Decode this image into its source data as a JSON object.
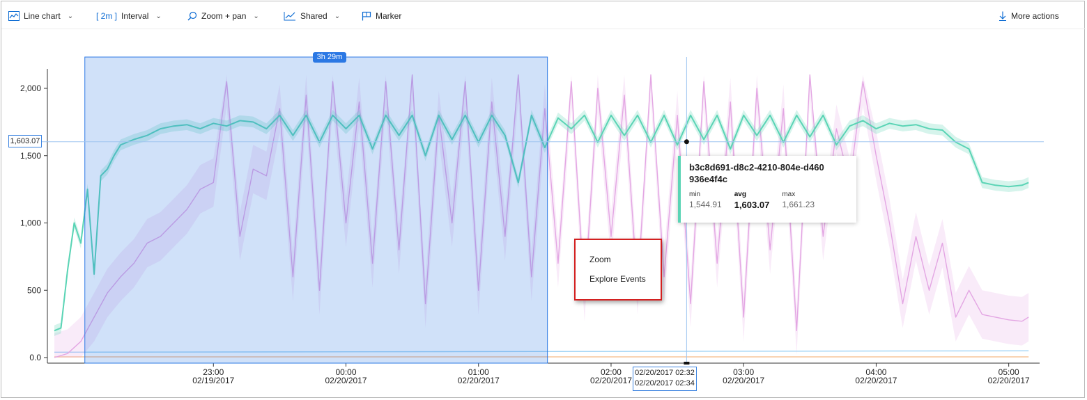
{
  "toolbar": {
    "chart_type_label": "Line chart",
    "interval_value": "[ 2m ]",
    "interval_label": "Interval",
    "zoom_label": "Zoom + pan",
    "shared_label": "Shared",
    "marker_label": "Marker",
    "more_actions_label": "More actions"
  },
  "selection": {
    "duration_label": "3h 29m"
  },
  "hover": {
    "value_label": "1,603.07",
    "time_start": "02/20/2017 02:32",
    "time_end": "02/20/2017 02:34"
  },
  "tooltip": {
    "series_id": "b3c8d691-d8c2-4210-804e-d460936e4f4c",
    "color": "#5ad4b5",
    "min_label": "min",
    "min_value": "1,544.91",
    "avg_label": "avg",
    "avg_value": "1,603.07",
    "max_label": "max",
    "max_value": "1,661.23"
  },
  "context_menu": {
    "items": [
      "Zoom",
      "Explore Events"
    ]
  },
  "colors": {
    "teal": "#5ad4b5",
    "pink": "#e3a6e3",
    "light_blue": "#9fd3f5",
    "orange": "#f7c59a",
    "selection": "#2b78e4",
    "accent": "#0c6bd3"
  },
  "chart_data": {
    "type": "line",
    "y_ticks": [
      {
        "value": 0,
        "label": "0.0"
      },
      {
        "value": 500,
        "label": "500"
      },
      {
        "value": 1000,
        "label": "1,000"
      },
      {
        "value": 1500,
        "label": "1,500"
      },
      {
        "value": 2000,
        "label": "2,000"
      }
    ],
    "ylim": [
      0,
      2150
    ],
    "xlim": [
      "02/19/2017 21:48",
      "02/20/2017 05:10"
    ],
    "x_ticks": [
      {
        "time": "23:00",
        "date": "02/19/2017",
        "hours": 1.2
      },
      {
        "time": "00:00",
        "date": "02/20/2017",
        "hours": 2.2
      },
      {
        "time": "01:00",
        "date": "02/20/2017",
        "hours": 3.2
      },
      {
        "time": "02:00",
        "date": "02/20/2017",
        "hours": 4.2
      },
      {
        "time": "03:00",
        "date": "02/20/2017",
        "hours": 5.2
      },
      {
        "time": "04:00",
        "date": "02/20/2017",
        "hours": 6.2
      },
      {
        "time": "05:00",
        "date": "02/20/2017",
        "hours": 7.2
      }
    ],
    "x_hours_range": [
      0,
      7.37
    ],
    "selection_hours": [
      0.23,
      3.72
    ],
    "hover_hours": 4.77,
    "hover_value": 1603.07,
    "series": [
      {
        "color": "#5ad4b5",
        "x": [
          0.0,
          0.05,
          0.1,
          0.15,
          0.2,
          0.25,
          0.3,
          0.35,
          0.4,
          0.45,
          0.5,
          0.6,
          0.7,
          0.8,
          0.9,
          1.0,
          1.1,
          1.2,
          1.3,
          1.4,
          1.5,
          1.6,
          1.7,
          1.8,
          1.9,
          2.0,
          2.1,
          2.2,
          2.3,
          2.4,
          2.5,
          2.6,
          2.7,
          2.8,
          2.9,
          3.0,
          3.1,
          3.2,
          3.3,
          3.4,
          3.5,
          3.6,
          3.7,
          3.8,
          3.9,
          4.0,
          4.1,
          4.2,
          4.3,
          4.4,
          4.5,
          4.6,
          4.7,
          4.8,
          4.9,
          5.0,
          5.1,
          5.2,
          5.3,
          5.4,
          5.5,
          5.6,
          5.7,
          5.8,
          5.9,
          6.0,
          6.1,
          6.2,
          6.3,
          6.4,
          6.5,
          6.6,
          6.7,
          6.8,
          6.9,
          7.0,
          7.1,
          7.2,
          7.3,
          7.35
        ],
        "values": [
          200,
          220,
          650,
          1000,
          850,
          1250,
          620,
          1350,
          1400,
          1500,
          1580,
          1620,
          1650,
          1700,
          1720,
          1730,
          1700,
          1740,
          1720,
          1760,
          1750,
          1700,
          1800,
          1650,
          1800,
          1600,
          1800,
          1700,
          1800,
          1550,
          1800,
          1650,
          1800,
          1500,
          1800,
          1620,
          1800,
          1600,
          1800,
          1650,
          1300,
          1800,
          1560,
          1780,
          1700,
          1800,
          1600,
          1800,
          1650,
          1800,
          1600,
          1800,
          1580,
          1800,
          1620,
          1800,
          1550,
          1800,
          1650,
          1800,
          1600,
          1800,
          1640,
          1800,
          1580,
          1720,
          1760,
          1700,
          1740,
          1720,
          1730,
          1700,
          1690,
          1600,
          1550,
          1300,
          1280,
          1270,
          1280,
          1300
        ]
      },
      {
        "color": "#e3a6e3",
        "x": [
          0.0,
          0.1,
          0.2,
          0.3,
          0.4,
          0.5,
          0.6,
          0.7,
          0.8,
          0.9,
          1.0,
          1.1,
          1.2,
          1.3,
          1.4,
          1.5,
          1.6,
          1.7,
          1.8,
          1.9,
          2.0,
          2.1,
          2.2,
          2.3,
          2.4,
          2.5,
          2.6,
          2.7,
          2.8,
          2.9,
          3.0,
          3.1,
          3.2,
          3.3,
          3.4,
          3.5,
          3.6,
          3.7,
          3.8,
          3.9,
          4.0,
          4.1,
          4.2,
          4.3,
          4.4,
          4.5,
          4.6,
          4.7,
          4.8,
          4.9,
          5.0,
          5.1,
          5.2,
          5.3,
          5.4,
          5.5,
          5.6,
          5.7,
          5.8,
          5.9,
          6.0,
          6.1,
          6.2,
          6.3,
          6.4,
          6.5,
          6.6,
          6.7,
          6.8,
          6.9,
          7.0,
          7.1,
          7.2,
          7.3,
          7.35
        ],
        "values": [
          0,
          30,
          120,
          300,
          480,
          600,
          700,
          850,
          900,
          1000,
          1100,
          1250,
          1300,
          2050,
          900,
          1400,
          1350,
          1850,
          600,
          1950,
          500,
          2050,
          1000,
          1900,
          700,
          2050,
          800,
          2100,
          400,
          1800,
          1000,
          2050,
          500,
          1900,
          900,
          2100,
          600,
          1850,
          700,
          2050,
          450,
          2000,
          900,
          1950,
          500,
          2100,
          600,
          1800,
          400,
          2050,
          700,
          1900,
          300,
          2000,
          800,
          1850,
          200,
          2100,
          900,
          1700,
          1300,
          2050,
          1500,
          1000,
          400,
          900,
          500,
          850,
          300,
          500,
          320,
          300,
          280,
          270,
          300
        ]
      },
      {
        "color": "#9fd3f5",
        "x": [
          0.0,
          7.35
        ],
        "values": [
          40,
          50
        ]
      },
      {
        "color": "#f7c59a",
        "x": [
          0.0,
          7.35
        ],
        "values": [
          5,
          5
        ]
      }
    ]
  }
}
